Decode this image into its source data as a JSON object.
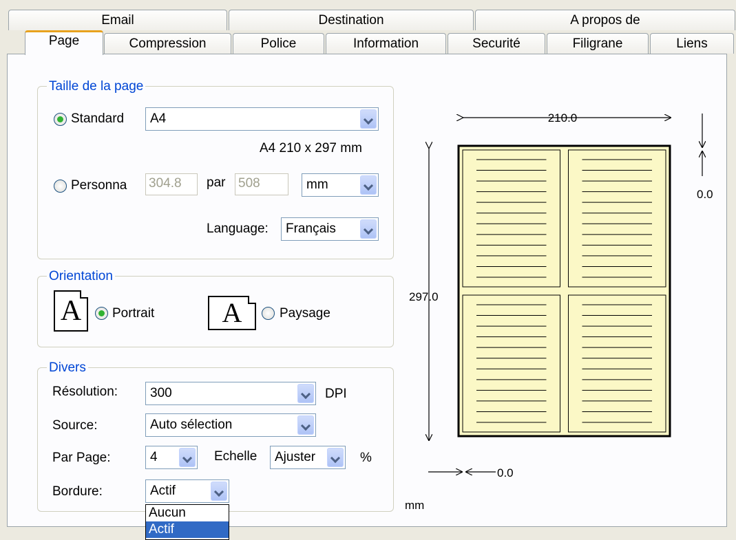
{
  "tabs_back": [
    "Email",
    "Destination",
    "A propos de"
  ],
  "tabs_front": [
    "Page",
    "Compression",
    "Police",
    "Information",
    "Securité",
    "Filigrane",
    "Liens"
  ],
  "page_size": {
    "legend": "Taille de la page",
    "standard_label": "Standard",
    "standard_value": "A4",
    "standard_desc": "A4 210 x 297 mm",
    "custom_label": "Personna",
    "width_value": "304.8",
    "par_label": "par",
    "height_value": "508",
    "unit_value": "mm",
    "language_label": "Language:",
    "language_value": "Français"
  },
  "orientation": {
    "legend": "Orientation",
    "portrait_label": "Portrait",
    "landscape_label": "Paysage",
    "icon_letter": "A"
  },
  "misc": {
    "legend": "Divers",
    "resolution_label": "Résolution:",
    "resolution_value": "300",
    "dpi_label": "DPI",
    "source_label": "Source:",
    "source_value": "Auto sélection",
    "per_page_label": "Par Page:",
    "per_page_value": "4",
    "scale_label": "Echelle",
    "scale_value": "Ajuster",
    "percent_label": "%",
    "border_label": "Bordure:",
    "border_value": "Actif",
    "border_options": [
      "Aucun",
      "Actif"
    ],
    "border_selected": "Actif"
  },
  "preview": {
    "width_value": "210.0",
    "height_value": "297.0",
    "top_margin": "0.0",
    "left_margin": "0.0",
    "unit": "mm",
    "pages_per_sheet": 4,
    "lines_per_page": 12,
    "page_color": "#fbf8c6"
  },
  "colors": {
    "group_legend": "#0046d5",
    "active_tab_accent": "#e8a21e",
    "radio_dot": "#31b233",
    "selection": "#316ac5"
  }
}
